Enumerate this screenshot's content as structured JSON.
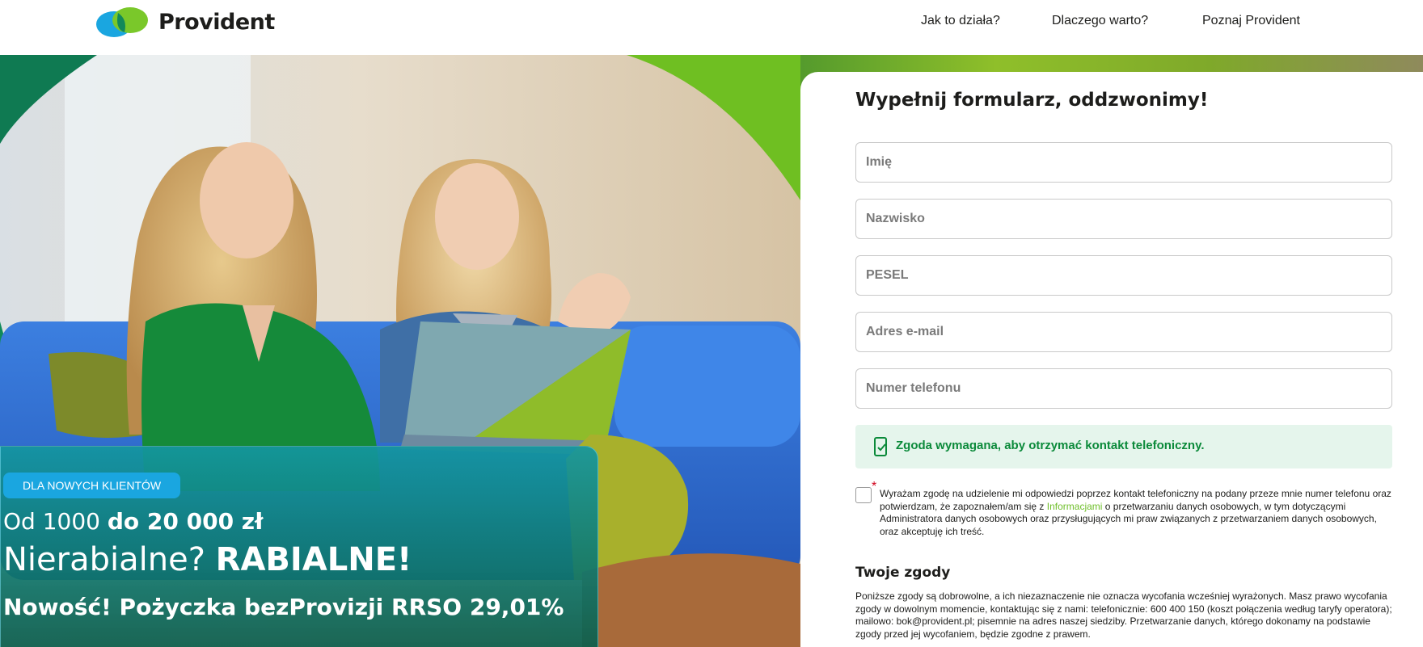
{
  "header": {
    "logo_text": "Provident",
    "nav": [
      "Jak to działa?",
      "Dlaczego warto?",
      "Poznaj Provident"
    ]
  },
  "promo": {
    "badge": "DLA NOWYCH KLIENTÓW",
    "amount_prefix": "Od 1000 ",
    "amount_bold": "do 20 000 zł",
    "slogan_prefix": "Nierabialne? ",
    "slogan_bold": "RABIALNE!",
    "offer": "Nowość! Pożyczka bezProvizji RRSO 29,01%"
  },
  "form": {
    "title": "Wypełnij formularz, oddzwonimy!",
    "fields": {
      "first_name": "Imię",
      "last_name": "Nazwisko",
      "pesel": "PESEL",
      "email": "Adres e-mail",
      "phone": "Numer telefonu"
    },
    "notice": "Zgoda wymagana, aby otrzymać kontakt telefoniczny.",
    "required_mark": "*",
    "consent_part1": "Wyrażam zgodę na udzielenie mi odpowiedzi poprzez kontakt telefoniczny na podany przeze mnie numer telefonu oraz potwierdzam, że zapoznałem/am się z ",
    "consent_link": "Informacjami",
    "consent_part2": " o przetwarzaniu danych osobowych, w tym dotyczącymi Administratora danych osobowych oraz przysługujących mi praw związanych z przetwarzaniem danych osobowych, oraz akceptuję ich treść.",
    "consents_title": "Twoje zgody",
    "consents_text": "Poniższe zgody są dobrowolne, a ich niezaznaczenie nie oznacza wycofania wcześniej wyrażonych. Masz prawo wycofania zgody w dowolnym momencie, kontaktując się z nami: telefonicznie: 600 400 150 (koszt połączenia według taryfy operatora); mailowo: bok@provident.pl; pisemnie na adres naszej siedziby. Przetwarzanie danych, którego dokonamy na podstawie zgody przed jej wycofaniem, będzie zgodne z prawem."
  },
  "colors": {
    "brand_blue": "#1aa6e0",
    "brand_green": "#7ac82a",
    "notice_bg": "#e5f5ec",
    "notice_text": "#0b8a3a"
  }
}
